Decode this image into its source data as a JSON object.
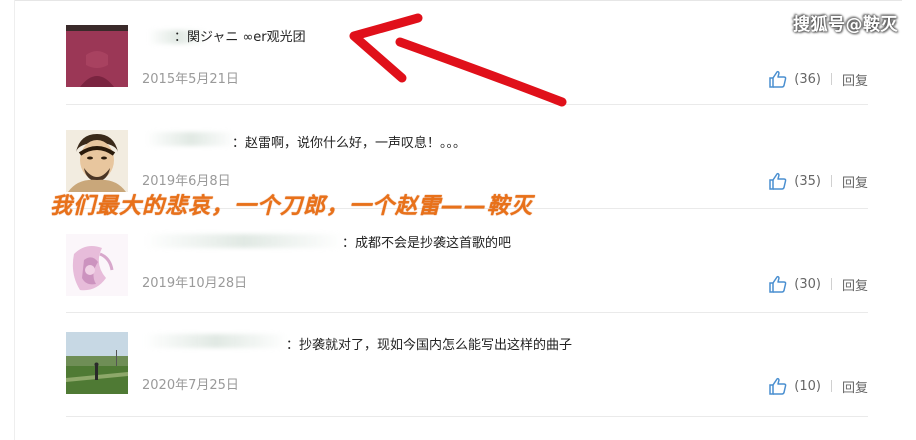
{
  "watermark": "搜狐号@鞍灭",
  "overlay_caption": "我们最大的悲哀，一个刀郎，一个赵雷——鞍灭",
  "comments": [
    {
      "text": "：関ジャニ ∞er观光团",
      "date": "2015年5月21日",
      "likes": "(36)",
      "reply": "回复"
    },
    {
      "text": "：赵雷啊，说你什么好，一声叹息！。。。",
      "date": "2019年6月8日",
      "likes": "(35)",
      "reply": "回复"
    },
    {
      "text": "：成都不会是抄袭这首歌的吧",
      "date": "2019年10月28日",
      "likes": "(30)",
      "reply": "回复"
    },
    {
      "text": "：抄袭就对了，现如今国内怎么能写出这样的曲子",
      "date": "2020年7月25日",
      "likes": "(10)",
      "reply": "回复"
    }
  ],
  "colors": {
    "like_icon": "#4a8fd0",
    "date_text": "#9a9a9a",
    "caption": "#e8711a",
    "arrow": "#e0101a"
  },
  "icons": {
    "like": "thumbs-up-icon",
    "annotation": "red-arrow"
  }
}
